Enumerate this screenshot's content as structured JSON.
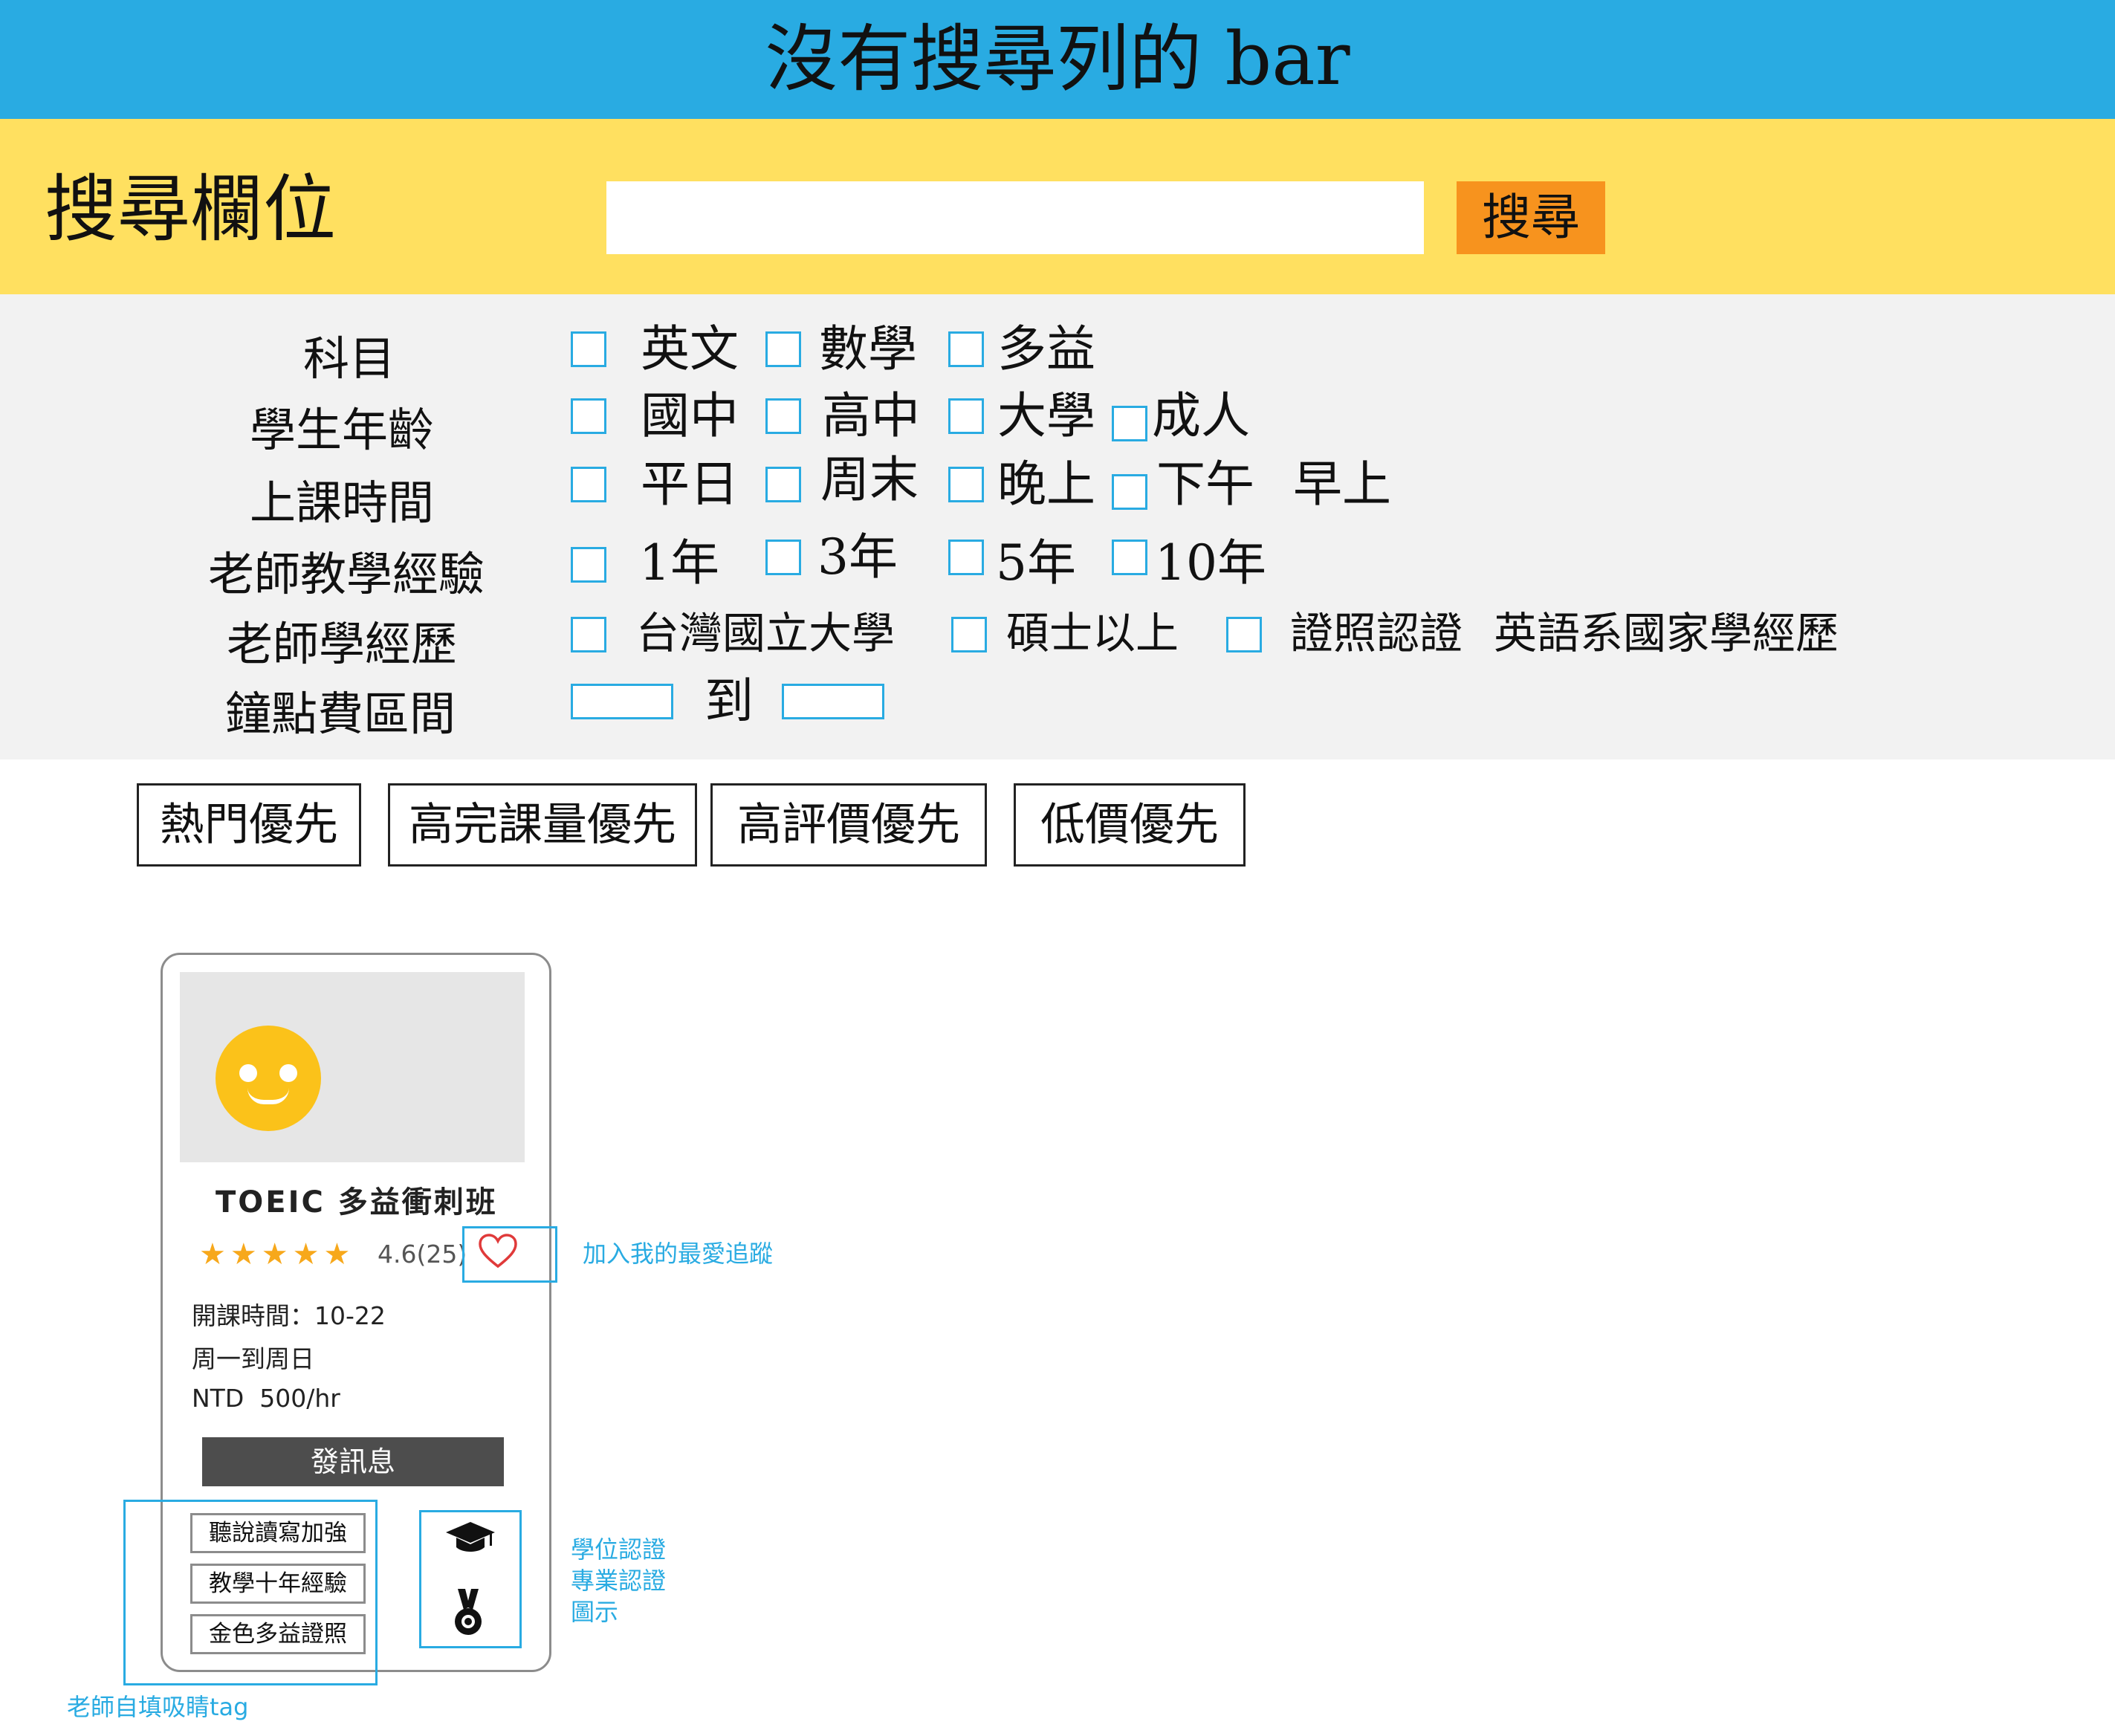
{
  "header": {
    "title": "沒有搜尋列的 bar",
    "bg_color": "#29abe2"
  },
  "search": {
    "label": "搜尋欄位",
    "input_value": "",
    "button_label": "搜尋",
    "bg_color": "#ffe060",
    "button_color": "#f7931e"
  },
  "filters": {
    "subject": {
      "label": "科目",
      "options": [
        "英文",
        "數學",
        "多益"
      ]
    },
    "age": {
      "label": "學生年齡",
      "options": [
        "國中",
        "高中",
        "大學",
        "成人"
      ]
    },
    "time": {
      "label": "上課時間",
      "options": [
        "平日",
        "周末",
        "晚上",
        "下午",
        "早上"
      ]
    },
    "experience": {
      "label": "老師教學經驗",
      "options": [
        "1年",
        "3年",
        "5年",
        "10年"
      ]
    },
    "education": {
      "label": "老師學經歷",
      "options": [
        "台灣國立大學",
        "碩士以上",
        "證照認證",
        "英語系國家學經歷"
      ]
    },
    "price": {
      "label": "鐘點費區間",
      "to_label": "到",
      "min_value": "",
      "max_value": ""
    }
  },
  "sort": {
    "buttons": [
      "熱門優先",
      "高完課量優先",
      "高評價優先",
      "低價優先"
    ]
  },
  "card": {
    "title": "TOEIC 多益衝刺班",
    "stars": "★★★★★",
    "star_count": 5,
    "rating": "4.6(25)",
    "schedule": "開課時間：10-22",
    "days": "周一到周日",
    "price": "NTD  500/hr",
    "message_button": "發訊息",
    "tags": [
      "聽說讀寫加強",
      "教學十年經驗",
      "金色多益證照"
    ],
    "badge_icons": [
      "graduation-cap-icon",
      "medal-icon"
    ],
    "avatar_icon": "smiley-icon"
  },
  "annotations": {
    "favorite": "加入我的最愛追蹤",
    "certification_lines": [
      "學位認證",
      "專業認證",
      "圖示"
    ],
    "tags_note": "老師自填吸睛tag"
  }
}
